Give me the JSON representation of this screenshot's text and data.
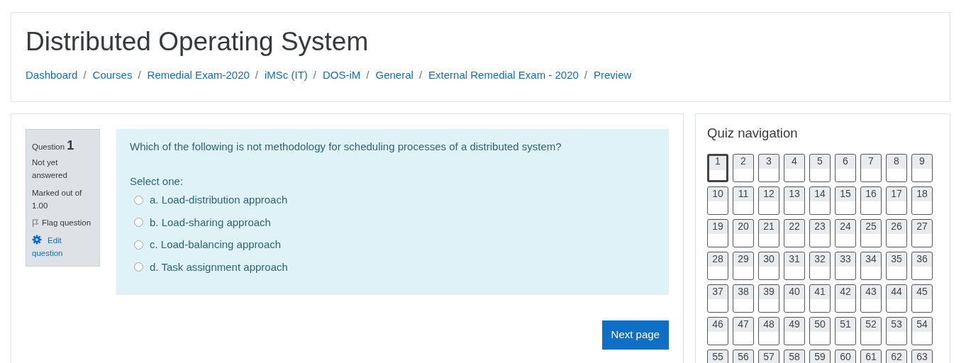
{
  "page_title": "Distributed Operating System",
  "breadcrumb": [
    "Dashboard",
    "Courses",
    "Remedial Exam-2020",
    "iMSc (IT)",
    "DOS-iM",
    "General",
    "External Remedial Exam - 2020",
    "Preview"
  ],
  "breadcrumb_separators": [
    "/",
    "/",
    "/",
    "/",
    "/",
    "/",
    "/"
  ],
  "question_info": {
    "label": "Question",
    "number": "1",
    "state": "Not yet answered",
    "marks": "Marked out of 1.00",
    "flag": "Flag question",
    "edit": "Edit question"
  },
  "question": {
    "text": "Which of the following is not methodology for scheduling processes of a distributed system?",
    "prompt": "Select one:",
    "options": [
      {
        "label": "a. Load-distribution approach",
        "checked": false
      },
      {
        "label": "b. Load-sharing approach",
        "checked": false
      },
      {
        "label": "c. Load-balancing approach",
        "checked": false
      },
      {
        "label": "d. Task assignment approach",
        "checked": false
      }
    ]
  },
  "next_button": "Next page",
  "quiz_navigation": {
    "title": "Quiz navigation",
    "buttons": [
      {
        "label": "1",
        "selected": true
      },
      {
        "label": "2",
        "selected": false
      },
      {
        "label": "3",
        "selected": false
      },
      {
        "label": "4",
        "selected": false
      },
      {
        "label": "5",
        "selected": false
      },
      {
        "label": "6",
        "selected": false
      },
      {
        "label": "7",
        "selected": false
      },
      {
        "label": "8",
        "selected": false
      },
      {
        "label": "9",
        "selected": false
      },
      {
        "label": "10",
        "selected": false
      },
      {
        "label": "11",
        "selected": false
      },
      {
        "label": "12",
        "selected": false
      },
      {
        "label": "13",
        "selected": false
      },
      {
        "label": "14",
        "selected": false
      },
      {
        "label": "15",
        "selected": false
      },
      {
        "label": "16",
        "selected": false
      },
      {
        "label": "17",
        "selected": false
      },
      {
        "label": "18",
        "selected": false
      },
      {
        "label": "19",
        "selected": false
      },
      {
        "label": "20",
        "selected": false
      },
      {
        "label": "21",
        "selected": false
      },
      {
        "label": "22",
        "selected": false
      },
      {
        "label": "23",
        "selected": false
      },
      {
        "label": "24",
        "selected": false
      },
      {
        "label": "25",
        "selected": false
      },
      {
        "label": "26",
        "selected": false
      },
      {
        "label": "27",
        "selected": false
      },
      {
        "label": "28",
        "selected": false
      },
      {
        "label": "29",
        "selected": false
      },
      {
        "label": "30",
        "selected": false
      },
      {
        "label": "31",
        "selected": false
      },
      {
        "label": "32",
        "selected": false
      },
      {
        "label": "33",
        "selected": false
      },
      {
        "label": "34",
        "selected": false
      },
      {
        "label": "35",
        "selected": false
      },
      {
        "label": "36",
        "selected": false
      },
      {
        "label": "37",
        "selected": false
      },
      {
        "label": "38",
        "selected": false
      },
      {
        "label": "39",
        "selected": false
      },
      {
        "label": "40",
        "selected": false
      },
      {
        "label": "41",
        "selected": false
      },
      {
        "label": "42",
        "selected": false
      },
      {
        "label": "43",
        "selected": false
      },
      {
        "label": "44",
        "selected": false
      },
      {
        "label": "45",
        "selected": false
      },
      {
        "label": "46",
        "selected": false
      },
      {
        "label": "47",
        "selected": false
      },
      {
        "label": "48",
        "selected": false
      },
      {
        "label": "49",
        "selected": false
      },
      {
        "label": "50",
        "selected": false
      },
      {
        "label": "51",
        "selected": false
      },
      {
        "label": "52",
        "selected": false
      },
      {
        "label": "53",
        "selected": false
      },
      {
        "label": "54",
        "selected": false
      },
      {
        "label": "55",
        "selected": false
      },
      {
        "label": "56",
        "selected": false
      },
      {
        "label": "57",
        "selected": false
      },
      {
        "label": "58",
        "selected": false
      },
      {
        "label": "59",
        "selected": false
      },
      {
        "label": "60",
        "selected": false
      },
      {
        "label": "61",
        "selected": false
      },
      {
        "label": "62",
        "selected": false
      },
      {
        "label": "63",
        "selected": false
      }
    ]
  }
}
